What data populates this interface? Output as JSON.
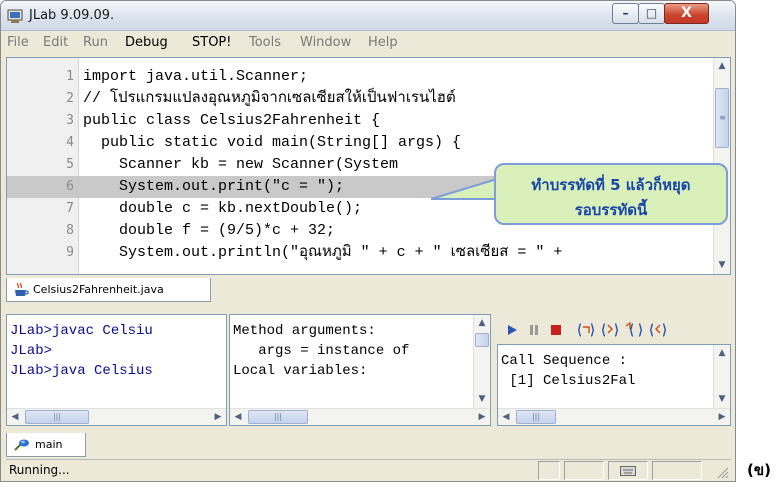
{
  "window": {
    "title": "JLab 9.09.09.",
    "controls": {
      "minimize": "–",
      "maximize": "□",
      "close": "X"
    }
  },
  "menu": [
    {
      "label": "File",
      "active": false
    },
    {
      "label": "Edit",
      "active": false
    },
    {
      "label": "Run",
      "active": false
    },
    {
      "label": "Debug",
      "active": true
    },
    {
      "label": "STOP!",
      "active": true
    },
    {
      "label": "Tools",
      "active": false
    },
    {
      "label": "Window",
      "active": false
    },
    {
      "label": "Help",
      "active": false
    }
  ],
  "editor": {
    "current_line": 6,
    "lines": [
      {
        "no": "1",
        "text": "import java.util.Scanner;"
      },
      {
        "no": "2",
        "text": "// โปรแกรมแปลงอุณหภูมิจากเซลเซียสให้เป็นฟาเรนไฮต์"
      },
      {
        "no": "3",
        "text": "public class Celsius2Fahrenheit {"
      },
      {
        "no": "4",
        "text": "  public static void main(String[] args) {"
      },
      {
        "no": "5",
        "text": "    Scanner kb = new Scanner(System"
      },
      {
        "no": "6",
        "text": "    System.out.print(\"c = \");"
      },
      {
        "no": "7",
        "text": "    double c = kb.nextDouble();"
      },
      {
        "no": "8",
        "text": "    double f = (9/5)*c + 32;"
      },
      {
        "no": "9",
        "text": "    System.out.println(\"อุณหภูมิ \" + c + \" เซลเซียส = \" +"
      }
    ]
  },
  "callout": {
    "line1": "ทำบรรทัดที่ 5 แล้วก็หยุด",
    "line2": "รอบรรทัดนี้"
  },
  "document_tab": {
    "label": "Celsius2Fahrenheit.java"
  },
  "console": {
    "lines": [
      "JLab>javac Celsiu",
      "JLab>",
      "JLab>java Celsius"
    ]
  },
  "variables": {
    "lines": [
      "Method arguments:",
      "   args = instance of",
      "Local variables:"
    ]
  },
  "call_sequence": {
    "lines": [
      "Call Sequence :",
      " [1] Celsius2Fal"
    ]
  },
  "debug_toolbar": {
    "icons": [
      "run-icon",
      "pause-icon",
      "stop-icon",
      "step-over-icon",
      "step-into-icon",
      "step-out-icon",
      "step-back-icon"
    ]
  },
  "thread_tab": {
    "label": "main"
  },
  "status": {
    "text": "Running..."
  },
  "figure_label": "(ข)",
  "colors": {
    "highlight_line": "#c9c9c9",
    "callout_fill": "#d9f0ba",
    "callout_border": "#7c9dd8",
    "callout_text": "#1846a8",
    "console_text": "#0a0a9a"
  }
}
